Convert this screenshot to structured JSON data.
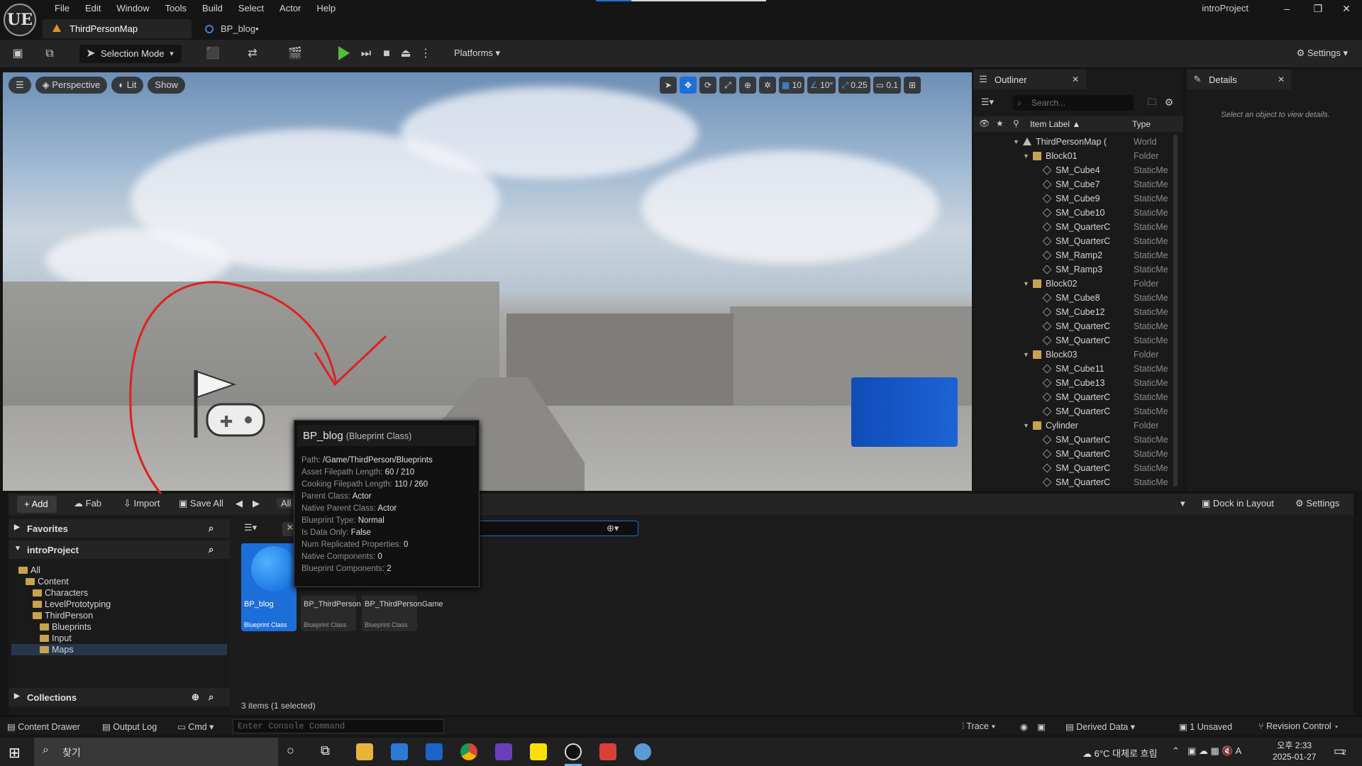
{
  "app": {
    "logo": "UE",
    "menu": [
      "File",
      "Edit",
      "Window",
      "Tools",
      "Build",
      "Select",
      "Actor",
      "Help"
    ],
    "project_name": "introProject",
    "tabs": [
      {
        "label": "ThirdPersonMap",
        "icon": "level-icon"
      },
      {
        "label": "BP_blog•",
        "icon": "blueprint-icon"
      }
    ],
    "window_buttons": [
      "–",
      "❐",
      "✕"
    ]
  },
  "toolbar": {
    "selection_mode": "Selection Mode",
    "platforms": "Platforms",
    "settings": "Settings"
  },
  "viewport": {
    "perspective": "Perspective",
    "lit": "Lit",
    "show": "Show",
    "grid_snap": "10",
    "rotation_snap": "10°",
    "scale_snap": "0.25",
    "camera_speed": "0.1"
  },
  "outliner": {
    "title": "Outliner",
    "search_placeholder": "Search...",
    "col_label": "Item Label ▲",
    "col_type": "Type",
    "rows": [
      {
        "name": "ThirdPersonMap (",
        "type": "World",
        "indent": 0,
        "kind": "world"
      },
      {
        "name": "Block01",
        "type": "Folder",
        "indent": 1,
        "kind": "folder"
      },
      {
        "name": "SM_Cube4",
        "type": "StaticMe",
        "indent": 2,
        "kind": "mesh"
      },
      {
        "name": "SM_Cube7",
        "type": "StaticMe",
        "indent": 2,
        "kind": "mesh"
      },
      {
        "name": "SM_Cube9",
        "type": "StaticMe",
        "indent": 2,
        "kind": "mesh"
      },
      {
        "name": "SM_Cube10",
        "type": "StaticMe",
        "indent": 2,
        "kind": "mesh"
      },
      {
        "name": "SM_QuarterC",
        "type": "StaticMe",
        "indent": 2,
        "kind": "mesh"
      },
      {
        "name": "SM_QuarterC",
        "type": "StaticMe",
        "indent": 2,
        "kind": "mesh"
      },
      {
        "name": "SM_Ramp2",
        "type": "StaticMe",
        "indent": 2,
        "kind": "mesh"
      },
      {
        "name": "SM_Ramp3",
        "type": "StaticMe",
        "indent": 2,
        "kind": "mesh"
      },
      {
        "name": "Block02",
        "type": "Folder",
        "indent": 1,
        "kind": "folder"
      },
      {
        "name": "SM_Cube8",
        "type": "StaticMe",
        "indent": 2,
        "kind": "mesh"
      },
      {
        "name": "SM_Cube12",
        "type": "StaticMe",
        "indent": 2,
        "kind": "mesh"
      },
      {
        "name": "SM_QuarterC",
        "type": "StaticMe",
        "indent": 2,
        "kind": "mesh"
      },
      {
        "name": "SM_QuarterC",
        "type": "StaticMe",
        "indent": 2,
        "kind": "mesh"
      },
      {
        "name": "Block03",
        "type": "Folder",
        "indent": 1,
        "kind": "folder"
      },
      {
        "name": "SM_Cube11",
        "type": "StaticMe",
        "indent": 2,
        "kind": "mesh"
      },
      {
        "name": "SM_Cube13",
        "type": "StaticMe",
        "indent": 2,
        "kind": "mesh"
      },
      {
        "name": "SM_QuarterC",
        "type": "StaticMe",
        "indent": 2,
        "kind": "mesh"
      },
      {
        "name": "SM_QuarterC",
        "type": "StaticMe",
        "indent": 2,
        "kind": "mesh"
      },
      {
        "name": "Cylinder",
        "type": "Folder",
        "indent": 1,
        "kind": "folder"
      },
      {
        "name": "SM_QuarterC",
        "type": "StaticMe",
        "indent": 2,
        "kind": "mesh"
      },
      {
        "name": "SM_QuarterC",
        "type": "StaticMe",
        "indent": 2,
        "kind": "mesh"
      },
      {
        "name": "SM_QuarterC",
        "type": "StaticMe",
        "indent": 2,
        "kind": "mesh"
      },
      {
        "name": "SM_QuarterC",
        "type": "StaticMe",
        "indent": 2,
        "kind": "mesh"
      }
    ]
  },
  "details": {
    "title": "Details",
    "empty_message": "Select an object to view details."
  },
  "content_browser": {
    "add": "Add",
    "fab": "Fab",
    "import": "Import",
    "save_all": "Save All",
    "all": "All",
    "dock_in_layout": "Dock in Layout",
    "settings": "Settings",
    "favorites": "Favorites",
    "project": "introProject",
    "collections": "Collections",
    "tree": [
      {
        "label": "All",
        "depth": 0
      },
      {
        "label": "Content",
        "depth": 1
      },
      {
        "label": "Characters",
        "depth": 2
      },
      {
        "label": "LevelPrototyping",
        "depth": 2
      },
      {
        "label": "ThirdPerson",
        "depth": 2
      },
      {
        "label": "Blueprints",
        "depth": 3
      },
      {
        "label": "Input",
        "depth": 3
      },
      {
        "label": "Maps",
        "depth": 3
      }
    ],
    "assets": [
      {
        "name": "BP_blog",
        "class": "Blueprint Class"
      },
      {
        "name": "BP_ThirdPerson",
        "class": "Blueprint Class"
      },
      {
        "name": "BP_ThirdPersonGame",
        "class": "Blueprint Class"
      }
    ],
    "count": "3 items (1 selected)"
  },
  "tooltip": {
    "title": "BP_blog",
    "subtitle": "(Blueprint Class)",
    "props": [
      {
        "k": "Path:",
        "v": "/Game/ThirdPerson/Blueprints"
      },
      {
        "k": "Asset Filepath Length:",
        "v": "60 / 210"
      },
      {
        "k": "Cooking Filepath Length:",
        "v": "110 / 260"
      },
      {
        "k": "Parent Class:",
        "v": "Actor"
      },
      {
        "k": "Native Parent Class:",
        "v": "Actor"
      },
      {
        "k": "Blueprint Type:",
        "v": "Normal"
      },
      {
        "k": "Is Data Only:",
        "v": "False"
      },
      {
        "k": "Num Replicated Properties:",
        "v": "0"
      },
      {
        "k": "Native Components:",
        "v": "0"
      },
      {
        "k": "Blueprint Components:",
        "v": "2"
      }
    ]
  },
  "statusbar": {
    "content_drawer": "Content Drawer",
    "output_log": "Output Log",
    "cmd": "Cmd",
    "console_placeholder": "Enter Console Command",
    "trace": "Trace",
    "derived_data": "Derived Data",
    "unsaved": "1 Unsaved",
    "revision_control": "Revision Control"
  },
  "taskbar": {
    "search": "찾기",
    "weather": "6°C  대체로 흐림",
    "time": "오후 2:33",
    "date": "2025-01-27",
    "notifications": "2"
  }
}
